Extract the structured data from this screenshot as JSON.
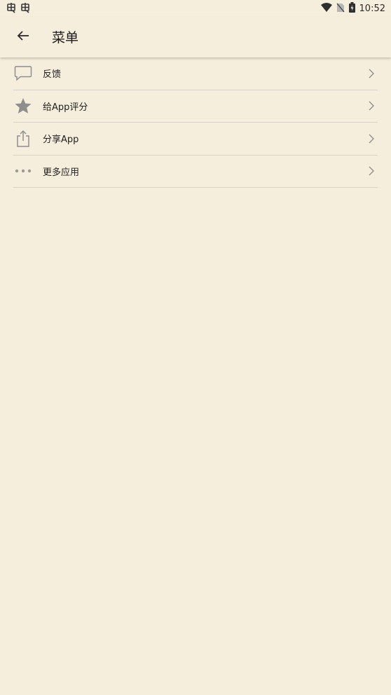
{
  "status_bar": {
    "time": "10:52",
    "notification_icons": [
      "bug-icon",
      "bug-icon"
    ],
    "system_icons": [
      "wifi-icon",
      "no-sim-icon",
      "battery-icon"
    ]
  },
  "app_bar": {
    "title": "菜单",
    "back_icon": "arrow-left-icon"
  },
  "menu": {
    "items": [
      {
        "label": "反馈",
        "icon": "chat-bubble-icon"
      },
      {
        "label": "给App评分",
        "icon": "star-icon"
      },
      {
        "label": "分享App",
        "icon": "share-icon"
      },
      {
        "label": "更多应用",
        "icon": "more-horizontal-icon"
      }
    ]
  },
  "colors": {
    "background": "#f6eedd",
    "divider": "#d8d2c4",
    "icon": "#8e8e8e",
    "text": "#1f1f1f"
  }
}
